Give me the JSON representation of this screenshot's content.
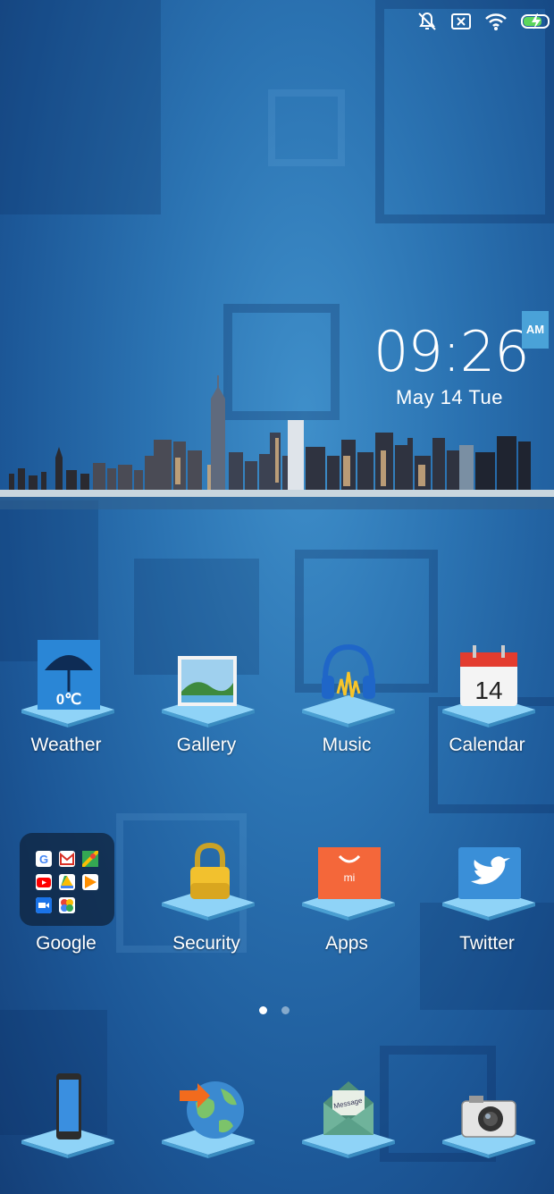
{
  "status_bar": {
    "icons": [
      "mute-icon",
      "sim-disabled-icon",
      "wifi-icon",
      "battery-charging-icon"
    ]
  },
  "clock": {
    "time": "09:26",
    "ampm": "AM",
    "date": "May  14  Tue"
  },
  "apps": [
    {
      "label": "Weather",
      "icon": "weather-icon",
      "icon_text": "0℃"
    },
    {
      "label": "Gallery",
      "icon": "gallery-icon"
    },
    {
      "label": "Music",
      "icon": "music-icon"
    },
    {
      "label": "Calendar",
      "icon": "calendar-icon",
      "icon_text": "14"
    },
    {
      "label": "Google",
      "icon": "google-folder-icon"
    },
    {
      "label": "Security",
      "icon": "lock-icon"
    },
    {
      "label": "Apps",
      "icon": "mi-store-icon",
      "icon_text": "mi"
    },
    {
      "label": "Twitter",
      "icon": "twitter-bird-icon"
    }
  ],
  "pager": {
    "pages": 2,
    "current": 1
  },
  "dock": [
    {
      "icon": "phone-icon"
    },
    {
      "icon": "browser-globe-icon"
    },
    {
      "icon": "messaging-envelope-icon",
      "icon_text": "Message"
    },
    {
      "icon": "camera-icon"
    }
  ],
  "colors": {
    "accent": "#4aa2d8",
    "pedestal": "#7ec8f2"
  }
}
